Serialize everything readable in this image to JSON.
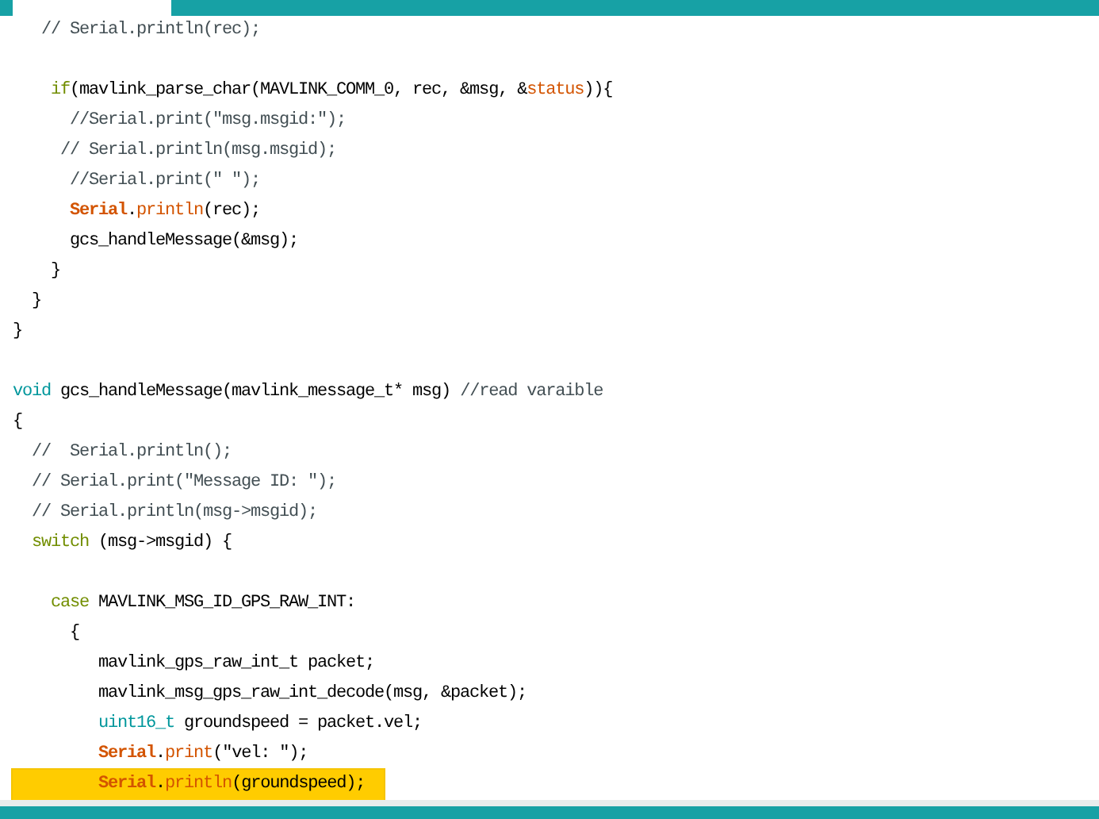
{
  "editor": {
    "blocks": [
      {
        "lines": [
          {
            "highlighted": false,
            "segments": [
              {
                "kind": "comment",
                "text": "   // Serial.println(rec);"
              }
            ]
          }
        ]
      },
      {
        "lines": [
          {
            "highlighted": false,
            "segments": [
              {
                "kind": "control",
                "text": "    if"
              },
              {
                "kind": "plain",
                "text": "(mavlink_parse_char(MAVLINK_COMM_0, rec, &msg, &"
              },
              {
                "kind": "function",
                "text": "status"
              },
              {
                "kind": "plain",
                "text": ")){"
              }
            ]
          },
          {
            "highlighted": false,
            "segments": [
              {
                "kind": "comment",
                "text": "      //Serial.print(\"msg.msgid:\");"
              }
            ]
          },
          {
            "highlighted": false,
            "segments": [
              {
                "kind": "comment",
                "text": "     // Serial.println(msg.msgid);"
              }
            ]
          },
          {
            "highlighted": false,
            "segments": [
              {
                "kind": "comment",
                "text": "      //Serial.print(\" \");"
              }
            ]
          },
          {
            "highlighted": false,
            "segments": [
              {
                "kind": "class",
                "text": "      Serial"
              },
              {
                "kind": "plain",
                "text": "."
              },
              {
                "kind": "function",
                "text": "println"
              },
              {
                "kind": "plain",
                "text": "(rec);"
              }
            ]
          },
          {
            "highlighted": false,
            "segments": [
              {
                "kind": "plain",
                "text": "      gcs_handleMessage(&msg);"
              }
            ]
          },
          {
            "highlighted": false,
            "segments": [
              {
                "kind": "plain",
                "text": "    }"
              }
            ]
          },
          {
            "highlighted": false,
            "segments": [
              {
                "kind": "plain",
                "text": "  }"
              }
            ]
          },
          {
            "highlighted": false,
            "segments": [
              {
                "kind": "plain",
                "text": "}"
              }
            ]
          }
        ]
      },
      {
        "lines": [
          {
            "highlighted": false,
            "segments": [
              {
                "kind": "type",
                "text": "void"
              },
              {
                "kind": "plain",
                "text": " gcs_handleMessage(mavlink_message_t* msg) "
              },
              {
                "kind": "comment",
                "text": "//read varaible"
              }
            ]
          },
          {
            "highlighted": false,
            "segments": [
              {
                "kind": "plain",
                "text": "{"
              }
            ]
          },
          {
            "highlighted": false,
            "segments": [
              {
                "kind": "comment",
                "text": "  //  Serial.println();"
              }
            ]
          },
          {
            "highlighted": false,
            "segments": [
              {
                "kind": "comment",
                "text": "  // Serial.print(\"Message ID: \");"
              }
            ]
          },
          {
            "highlighted": false,
            "segments": [
              {
                "kind": "comment",
                "text": "  // Serial.println(msg->msgid);"
              }
            ]
          },
          {
            "highlighted": false,
            "segments": [
              {
                "kind": "control",
                "text": "  switch"
              },
              {
                "kind": "plain",
                "text": " (msg->msgid) {"
              }
            ]
          }
        ]
      },
      {
        "lines": [
          {
            "highlighted": false,
            "segments": [
              {
                "kind": "control",
                "text": "    case"
              },
              {
                "kind": "plain",
                "text": " MAVLINK_MSG_ID_GPS_RAW_INT:"
              }
            ]
          },
          {
            "highlighted": false,
            "segments": [
              {
                "kind": "plain",
                "text": "      {"
              }
            ]
          },
          {
            "highlighted": false,
            "segments": [
              {
                "kind": "plain",
                "text": "         mavlink_gps_raw_int_t packet;"
              }
            ]
          },
          {
            "highlighted": false,
            "segments": [
              {
                "kind": "plain",
                "text": "         mavlink_msg_gps_raw_int_decode(msg, &packet);"
              }
            ]
          },
          {
            "highlighted": false,
            "segments": [
              {
                "kind": "type",
                "text": "         uint16_t"
              },
              {
                "kind": "plain",
                "text": " groundspeed = packet.vel;"
              }
            ]
          },
          {
            "highlighted": false,
            "segments": [
              {
                "kind": "class",
                "text": "         Serial"
              },
              {
                "kind": "plain",
                "text": "."
              },
              {
                "kind": "function",
                "text": "print"
              },
              {
                "kind": "plain",
                "text": "(\"vel: \");"
              }
            ]
          },
          {
            "highlighted": true,
            "segments": [
              {
                "kind": "class",
                "text": "         Serial"
              },
              {
                "kind": "plain",
                "text": "."
              },
              {
                "kind": "function",
                "text": "println"
              },
              {
                "kind": "plain",
                "text": "(groundspeed);"
              }
            ]
          }
        ]
      }
    ]
  }
}
